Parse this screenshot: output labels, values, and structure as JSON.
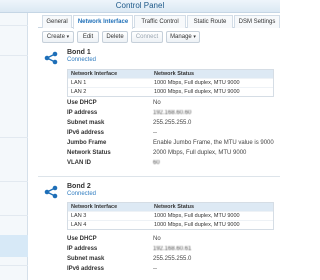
{
  "window": {
    "title": "Control Panel"
  },
  "tabs": [
    "General",
    "Network Interface",
    "Traffic Control",
    "Static Route",
    "DSM Settings"
  ],
  "toolbar": {
    "create": "Create",
    "edit": "Edit",
    "delete": "Delete",
    "connect": "Connect",
    "manage": "Manage"
  },
  "columns": {
    "interface": "Network Interface",
    "status": "Network Status"
  },
  "labels": {
    "use_dhcp": "Use DHCP",
    "ip_address": "IP address",
    "subnet_mask": "Subnet mask",
    "ipv6_address": "IPv6 address",
    "jumbo_frame": "Jumbo Frame",
    "network_status": "Network Status",
    "vlan_id": "VLAN ID"
  },
  "bond1": {
    "name": "Bond 1",
    "status": "Connected",
    "rows": [
      {
        "iface": "LAN 1",
        "status": "1000 Mbps, Full duplex, MTU 9000"
      },
      {
        "iface": "LAN 2",
        "status": "1000 Mbps, Full duplex, MTU 9000"
      }
    ],
    "use_dhcp": "No",
    "ip_address": "192.168.60.60",
    "subnet_mask": "255.255.255.0",
    "ipv6_address": "--",
    "jumbo_frame": "Enable Jumbo Frame, the MTU value is 9000",
    "network_status": "2000 Mbps, Full duplex, MTU 9000",
    "vlan_id": "60"
  },
  "bond2": {
    "name": "Bond 2",
    "status": "Connected",
    "rows": [
      {
        "iface": "LAN 3",
        "status": "1000 Mbps, Full duplex, MTU 9000"
      },
      {
        "iface": "LAN 4",
        "status": "1000 Mbps, Full duplex, MTU 9000"
      }
    ],
    "use_dhcp": "No",
    "ip_address": "192.168.60.61",
    "subnet_mask": "255.255.255.0",
    "ipv6_address": "--"
  },
  "icons": {
    "bond": "network-bond-icon",
    "caret": "chevron-down-icon"
  },
  "colors": {
    "accent": "#1e6fb8",
    "connected": "#2f7cc0",
    "header_bg": "#dde9f4"
  }
}
